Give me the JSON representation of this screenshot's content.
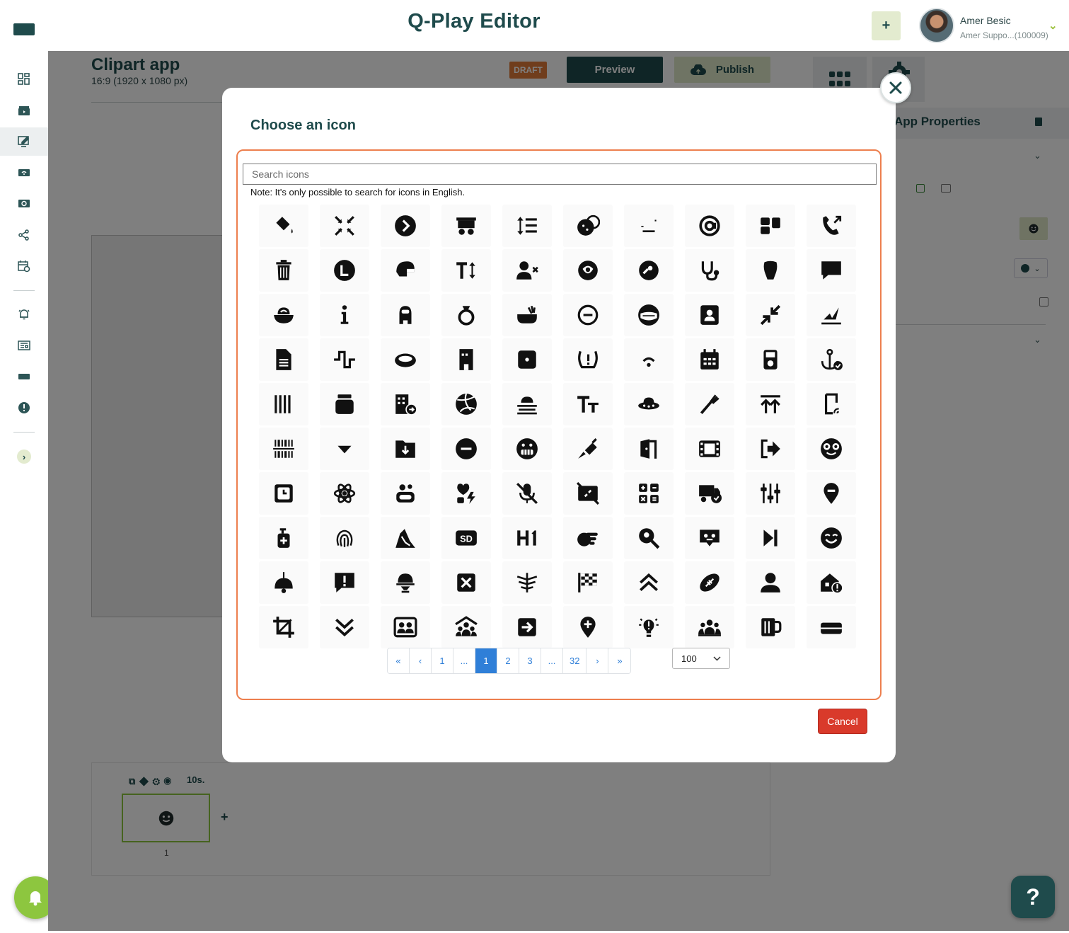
{
  "header": {
    "app_title": "Q-Play Editor",
    "add_label": "+",
    "user_name": "Amer Besic",
    "user_sub": "Amer Suppo...(100009)"
  },
  "sidebar": {
    "expand_label": "›"
  },
  "editor": {
    "title": "Clipart app",
    "subtitle": "16:9 (1920 x 1080 px)",
    "draft_label": "DRAFT",
    "preview_label": "Preview",
    "publish_label": "Publish",
    "slide_tools": "⧉ ◆ ⚙ ◉",
    "slide_duration": "10s.",
    "slide_add": "+",
    "slide_number": "1"
  },
  "right_panel": {
    "header": "App Properties"
  },
  "modal": {
    "title": "Choose an icon",
    "search_placeholder": "Search icons",
    "note": "Note: It's only possible to search for icons in English.",
    "cancel_label": "Cancel",
    "icons": [
      "fill-drip-icon",
      "compress-arrows-icon",
      "circle-chevron-right-icon",
      "wagon-icon",
      "text-height-lines-icon",
      "cookie-icon",
      "face-sleep-icon",
      "at-icon",
      "grip-blocks-icon",
      "phone-arrow-icon",
      "trash-icon",
      "circle-l-icon",
      "helmet-icon",
      "text-height-icon",
      "user-xmark-icon",
      "hands-bowl-icon",
      "ping-pong-icon",
      "stethoscope-icon",
      "tooth-icon",
      "message-icon",
      "bowl-food-icon",
      "info-icon",
      "astronaut-icon",
      "ring-icon",
      "bath-icon",
      "circle-minus-icon",
      "face-mask-icon",
      "address-card-icon",
      "compress-icon",
      "burst-icon",
      "file-lines-icon",
      "wave-square-icon",
      "hat-disc-icon",
      "un-building-icon",
      "dice-one-icon",
      "tire-pressure-icon",
      "wifi-weak-icon",
      "calendar-days-icon",
      "ipod-icon",
      "anchor-check-icon",
      "bars-vertical-icon",
      "jar-icon",
      "building-arrow-icon",
      "volleyball-icon",
      "sun-haze-icon",
      "text-size-icon",
      "ufo-icon",
      "fork-icon",
      "arrows-up-line-icon",
      "mobile-signal-icon",
      "barcode-scan-icon",
      "caret-down-icon",
      "folder-download-icon",
      "circle-minus-solid-icon",
      "face-grimace-icon",
      "trowel-icon",
      "door-open-icon",
      "film-icon",
      "right-from-bracket-icon",
      "face-glasses-icon",
      "square-clock-icon",
      "atom-icon",
      "soap-icon",
      "heart-bolt-icon",
      "microphone-slash-icon",
      "rectangle-xmark-icon",
      "calculator-icon",
      "truck-check-icon",
      "sliders-icon",
      "location-pin-icon",
      "pump-soap-icon",
      "fingerprint-icon",
      "hill-icon",
      "sd-card-icon",
      "heading-one-icon",
      "hand-point-icon",
      "magnifying-glass-location-icon",
      "robot-message-icon",
      "forward-step-icon",
      "face-smile-icon",
      "ceiling-lamp-icon",
      "message-exclamation-icon",
      "bowl-lamp-icon",
      "square-xmark-icon",
      "wheat-icon",
      "flag-checkered-icon",
      "chevrons-up-icon",
      "football-icon",
      "user-icon",
      "house-circle-exclamation-icon",
      "crop-icon",
      "chevrons-down-icon",
      "people-rectangle-icon",
      "people-roof-icon",
      "square-arrow-right-icon",
      "location-plus-icon",
      "lightbulb-exclamation-icon",
      "people-group-icon",
      "mug-icon",
      "mattress-icon"
    ],
    "pagination": [
      "«",
      "‹",
      "1",
      "...",
      "1",
      "2",
      "3",
      "...",
      "32",
      "›",
      "»"
    ],
    "active_page": "1",
    "per_page": "100"
  }
}
